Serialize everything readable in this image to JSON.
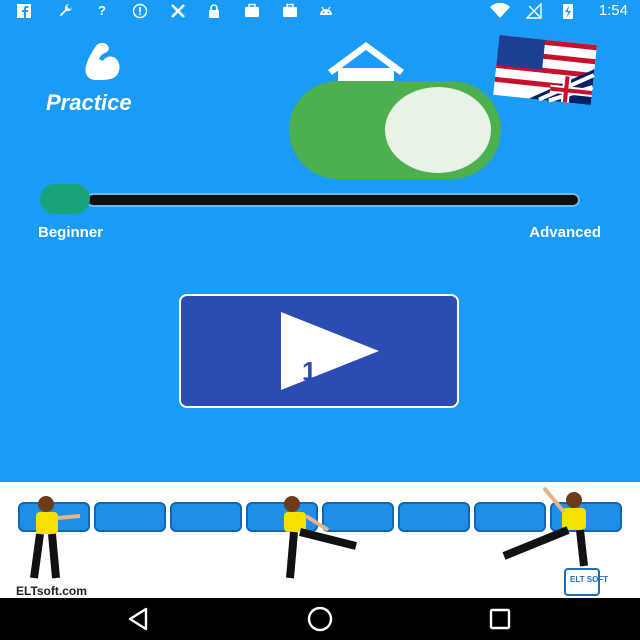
{
  "status_bar": {
    "time": "1:54",
    "icons": [
      "facebook-icon",
      "wrench-icon",
      "question-icon",
      "info-icon",
      "tools-icon",
      "lock-icon",
      "briefcase-icon",
      "briefcase-icon",
      "android-icon",
      "wifi-icon",
      "no-signal-icon",
      "battery-charging-icon"
    ]
  },
  "header": {
    "practice_label": "Practice",
    "practice_icon": "flexed-arm-icon",
    "home_icon": "home-icon",
    "flag_icon": "us-uk-flag-icon"
  },
  "toggle": {
    "state": "on",
    "color": "#4caf50"
  },
  "level_slider": {
    "min_label": "Beginner",
    "max_label": "Advanced",
    "value": 0
  },
  "play_button": {
    "number": "1",
    "color": "#2a4cb3"
  },
  "banner": {
    "brand_text": "ELTsoft.com",
    "logo_text": "ELT SOFT"
  },
  "nav_bar": {
    "icons": [
      "back-icon",
      "home-circle-icon",
      "recents-icon"
    ]
  },
  "colors": {
    "background": "#1a9bf5",
    "accent_green": "#4caf50",
    "slider_thumb": "#1aa37a"
  }
}
